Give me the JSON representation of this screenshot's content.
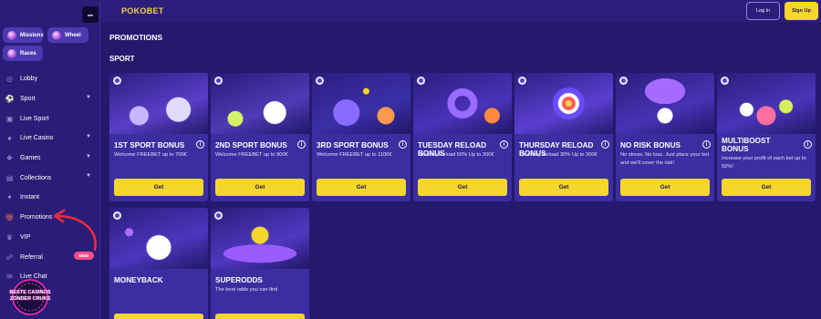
{
  "brand": {
    "logo_text": "POKOBET"
  },
  "header": {
    "login_label": "Log In",
    "signup_label": "Sign Up"
  },
  "sidebar": {
    "quick": [
      {
        "label": "Missions",
        "icon": "missions-icon"
      },
      {
        "label": "Wheel",
        "icon": "wheel-icon"
      },
      {
        "label": "Races",
        "icon": "races-icon"
      }
    ],
    "items": [
      {
        "label": "Lobby",
        "icon": "lobby-icon",
        "chevron": false
      },
      {
        "label": "Sport",
        "icon": "sport-icon",
        "chevron": true
      },
      {
        "label": "Live Sport",
        "icon": "live-sport-icon",
        "chevron": false
      },
      {
        "label": "Live Casino",
        "icon": "live-casino-icon",
        "chevron": true
      },
      {
        "label": "Games",
        "icon": "games-icon",
        "chevron": true
      },
      {
        "label": "Collections",
        "icon": "collections-icon",
        "chevron": true
      },
      {
        "label": "Instant",
        "icon": "instant-icon",
        "chevron": false
      },
      {
        "label": "Promotions",
        "icon": "gift-icon",
        "chevron": false
      },
      {
        "label": "VIP",
        "icon": "crown-icon",
        "chevron": false
      },
      {
        "label": "Referral",
        "icon": "referral-icon",
        "chevron": false,
        "badge": "NEW"
      },
      {
        "label": "Live Chat",
        "icon": "chat-icon",
        "chevron": false
      }
    ],
    "overlay_logo_text": "BESTE CASINOS ZONDER CRUKS"
  },
  "main": {
    "page_title": "PROMOTIONS",
    "section_title": "SPORT",
    "cta_label": "Get",
    "cards": [
      {
        "title": "1ST SPORT BONUS",
        "desc": "Welcome FREEBET up to 700€"
      },
      {
        "title": "2ND SPORT BONUS",
        "desc": "Welcome FREEBET up to 900€"
      },
      {
        "title": "3RD SPORT BONUS",
        "desc": "Welcome FREEBET up to 1100€"
      },
      {
        "title": "TUESDAY RELOAD BONUS",
        "desc": "Tuesday Reload 50% Up to 200€"
      },
      {
        "title": "THURSDAY RELOAD BONUS",
        "desc": "Thursday Reload 30% Up to 300€"
      },
      {
        "title": "NO RISK BONUS",
        "desc": "No stress. No loss. Just place your bet and we'll cover the risk!"
      },
      {
        "title": "MULTIBOOST BONUS",
        "desc": "Increase your profit of each bet up to 50%!"
      },
      {
        "title": "MONEYBACK",
        "desc": ""
      },
      {
        "title": "SUPERODDS",
        "desc": "The best odds you can find"
      }
    ]
  },
  "colors": {
    "accent": "#f5d62d",
    "background": "#25196e",
    "card": "#3a2ea0",
    "badge_new": "#ff4d8a"
  }
}
